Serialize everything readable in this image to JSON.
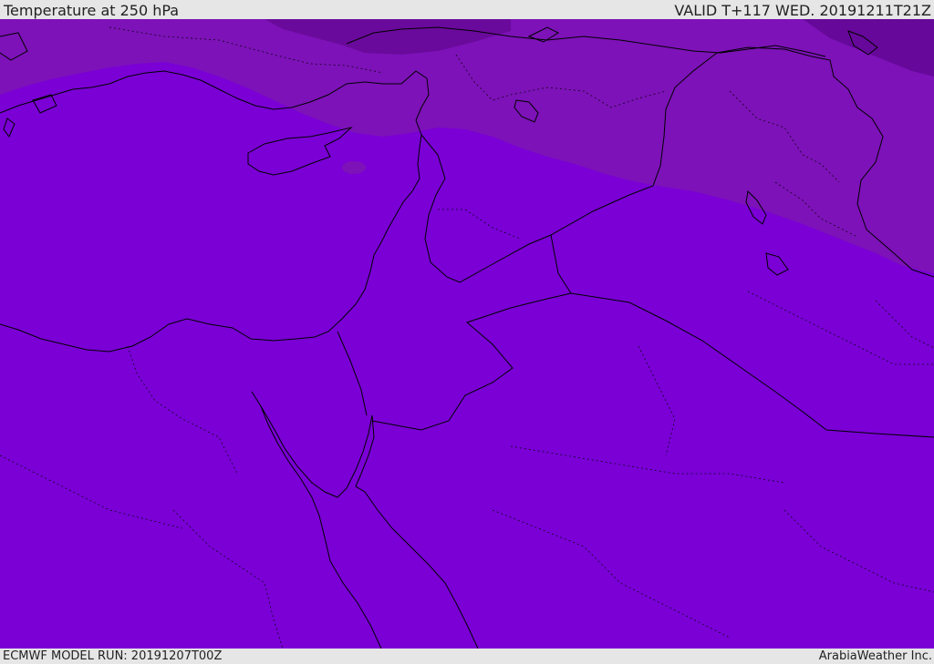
{
  "header": {
    "title": "Temperature at 250 hPa",
    "valid_time": "VALID T+117 WED. 20191211T21Z"
  },
  "footer": {
    "model_run": "ECMWF MODEL RUN: 20191207T00Z",
    "credit": "ArabiaWeather Inc."
  },
  "colors": {
    "field_main": "#7a00d6",
    "field_cold_band": "#7d12b8",
    "field_coldest": "#6a0a9c",
    "field_coldest_2": "#66089a",
    "boundary_line": "#000000",
    "frame_bg": "#e6e6e6"
  }
}
